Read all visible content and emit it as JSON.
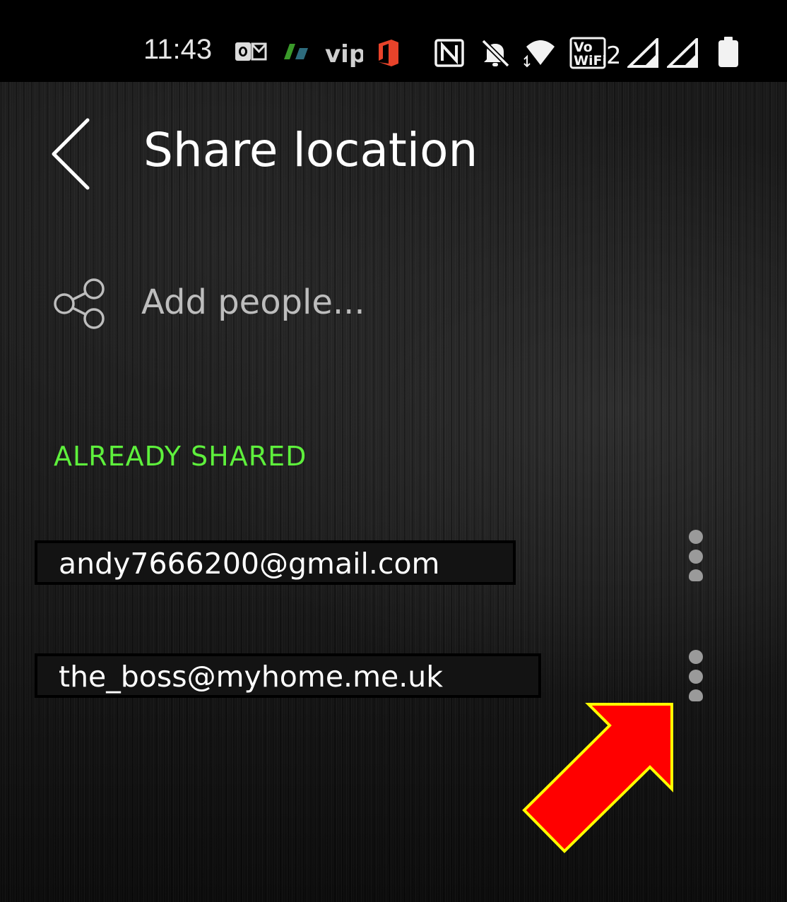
{
  "status_bar": {
    "time": "11:43",
    "icons": [
      "outlook-icon",
      "green-app-icon",
      "vip-icon",
      "office-icon",
      "nfc-icon",
      "bell-muted-icon",
      "wifi-icon",
      "vowifi-icon",
      "signal-icon",
      "signal-icon",
      "battery-icon"
    ],
    "vowifi_text": "VoWiFi",
    "vowifi_sim": "2",
    "vip_text": "vip"
  },
  "header": {
    "back_icon": "chevron-left-icon",
    "title": "Share location"
  },
  "add_people": {
    "icon": "share-icon",
    "label": "Add people..."
  },
  "already_shared": {
    "header": "ALREADY SHARED",
    "items": [
      {
        "email": "andy7666200@gmail.com",
        "menu_icon": "more-vertical-icon"
      },
      {
        "email": "the_boss@myhome.me.uk",
        "menu_icon": "more-vertical-icon"
      }
    ]
  },
  "annotation": {
    "icon": "arrow-icon",
    "fill_color": "#ff0000",
    "outline_color": "#ffff00"
  },
  "colors": {
    "accent": "#5ef03c",
    "title": "#ffffff",
    "muted_text": "#bdbdbd",
    "background": "#1a1a1a"
  }
}
